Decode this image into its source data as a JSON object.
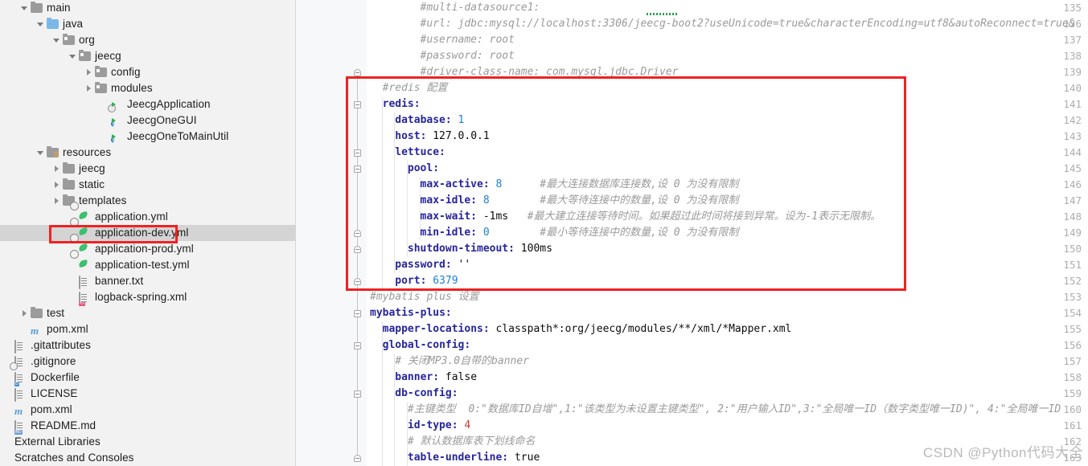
{
  "app": "IntelliJ IDEA project view with YAML editor",
  "sidebar": {
    "name": "project-tree",
    "items": [
      {
        "label": "main",
        "indent": 1,
        "arrow": "down",
        "icon": "folder-icon",
        "selected": false
      },
      {
        "label": "java",
        "indent": 2,
        "arrow": "down",
        "icon": "folder-source-icon",
        "selected": false
      },
      {
        "label": "org",
        "indent": 3,
        "arrow": "down",
        "icon": "folder-package-icon",
        "selected": false
      },
      {
        "label": "jeecg",
        "indent": 4,
        "arrow": "down",
        "icon": "folder-package-icon",
        "selected": false
      },
      {
        "label": "config",
        "indent": 5,
        "arrow": "right",
        "icon": "folder-package-icon",
        "selected": false
      },
      {
        "label": "modules",
        "indent": 5,
        "arrow": "right",
        "icon": "folder-package-icon",
        "selected": false
      },
      {
        "label": "JeecgApplication",
        "indent": 6,
        "arrow": "none",
        "icon": "java-class-run-icon",
        "selected": false
      },
      {
        "label": "JeecgOneGUI",
        "indent": 6,
        "arrow": "none",
        "icon": "java-class-icon",
        "selected": false
      },
      {
        "label": "JeecgOneToMainUtil",
        "indent": 6,
        "arrow": "none",
        "icon": "java-class-icon",
        "selected": false
      },
      {
        "label": "resources",
        "indent": 2,
        "arrow": "down",
        "icon": "folder-resources-icon",
        "selected": false
      },
      {
        "label": "jeecg",
        "indent": 3,
        "arrow": "right",
        "icon": "folder-icon",
        "selected": false
      },
      {
        "label": "static",
        "indent": 3,
        "arrow": "right",
        "icon": "folder-icon",
        "selected": false
      },
      {
        "label": "templates",
        "indent": 3,
        "arrow": "right",
        "icon": "folder-icon",
        "selected": false
      },
      {
        "label": "application.yml",
        "indent": 4,
        "arrow": "none",
        "icon": "yml-file-icon",
        "selected": false
      },
      {
        "label": "application-dev.yml",
        "indent": 4,
        "arrow": "none",
        "icon": "yml-file-icon",
        "selected": true
      },
      {
        "label": "application-prod.yml",
        "indent": 4,
        "arrow": "none",
        "icon": "yml-file-icon",
        "selected": false
      },
      {
        "label": "application-test.yml",
        "indent": 4,
        "arrow": "none",
        "icon": "yml-file-icon",
        "selected": false
      },
      {
        "label": "banner.txt",
        "indent": 4,
        "arrow": "none",
        "icon": "text-file-icon",
        "selected": false
      },
      {
        "label": "logback-spring.xml",
        "indent": 4,
        "arrow": "none",
        "icon": "xml-file-icon",
        "selected": false
      },
      {
        "label": "test",
        "indent": 1,
        "arrow": "right",
        "icon": "folder-icon",
        "selected": false
      },
      {
        "label": "pom.xml",
        "indent": 1,
        "arrow": "none",
        "icon": "maven-icon",
        "selected": false
      },
      {
        "label": ".gitattributes",
        "indent": 0,
        "arrow": "none",
        "icon": "text-file-icon",
        "selected": false
      },
      {
        "label": ".gitignore",
        "indent": 0,
        "arrow": "none",
        "icon": "gitignore-icon",
        "selected": false
      },
      {
        "label": "Dockerfile",
        "indent": 0,
        "arrow": "none",
        "icon": "docker-file-icon",
        "selected": false
      },
      {
        "label": "LICENSE",
        "indent": 0,
        "arrow": "none",
        "icon": "text-file-icon",
        "selected": false
      },
      {
        "label": "pom.xml",
        "indent": 0,
        "arrow": "none",
        "icon": "maven-icon",
        "selected": false
      },
      {
        "label": "README.md",
        "indent": 0,
        "arrow": "none",
        "icon": "markdown-file-icon",
        "selected": false
      },
      {
        "label": "External Libraries",
        "indent": 0,
        "arrow": "none",
        "icon": "none",
        "selected": false
      },
      {
        "label": "Scratches and Consoles",
        "indent": 0,
        "arrow": "none",
        "icon": "none",
        "selected": false
      }
    ]
  },
  "editor": {
    "name": "yaml-editor",
    "first_line_number": 135,
    "lines": [
      {
        "n": 135,
        "text": "#multi-datasource1:"
      },
      {
        "n": 136,
        "text": "#url: jdbc:mysql://localhost:3306/jeecg-boot2?useUnicode=true&characterEncoding=utf8&autoReconnect=true&"
      },
      {
        "n": 137,
        "text": "#username: root"
      },
      {
        "n": 138,
        "text": "#password: root"
      },
      {
        "n": 139,
        "text": "#driver-class-name: com.mysql.jdbc.Driver"
      },
      {
        "n": 140,
        "text": "#redis 配置"
      },
      {
        "n": 141,
        "text": "redis:"
      },
      {
        "n": 142,
        "text": "database: 1"
      },
      {
        "n": 143,
        "text": "host: 127.0.0.1"
      },
      {
        "n": 144,
        "text": "lettuce:"
      },
      {
        "n": 145,
        "text": "pool:"
      },
      {
        "n": 146,
        "text": "max-active: 8      #最大连接数据库连接数,设 0 为没有限制"
      },
      {
        "n": 147,
        "text": "max-idle: 8        #最大等待连接中的数量,设 0 为没有限制"
      },
      {
        "n": 148,
        "text": "max-wait: -1ms   #最大建立连接等待时间。如果超过此时间将接到异常。设为-1表示无限制。"
      },
      {
        "n": 149,
        "text": "min-idle: 0        #最小等待连接中的数量,设 0 为没有限制"
      },
      {
        "n": 150,
        "text": "shutdown-timeout: 100ms"
      },
      {
        "n": 151,
        "text": "password: ''"
      },
      {
        "n": 152,
        "text": "port: 6379"
      },
      {
        "n": 153,
        "text": "#mybatis plus 设置"
      },
      {
        "n": 154,
        "text": "mybatis-plus:"
      },
      {
        "n": 155,
        "text": "mapper-locations: classpath*:org/jeecg/modules/**/xml/*Mapper.xml"
      },
      {
        "n": 156,
        "text": "global-config:"
      },
      {
        "n": 157,
        "text": "# 关闭MP3.0自带的banner"
      },
      {
        "n": 158,
        "text": "banner: false"
      },
      {
        "n": 159,
        "text": "db-config:"
      },
      {
        "n": 160,
        "text": "#主键类型  0:\"数据库ID自增\",1:\"该类型为未设置主键类型\", 2:\"用户输入ID\",3:\"全局唯一ID（数字类型唯一ID)\", 4:\"全局唯一ID"
      },
      {
        "n": 161,
        "text": "id-type: 4"
      },
      {
        "n": 162,
        "text": "# 默认数据库表下划线命名"
      },
      {
        "n": 163,
        "text": "table-underline: true"
      }
    ],
    "values": {
      "database": "1",
      "host": "127.0.0.1",
      "max_active": "8",
      "max_idle": "8",
      "max_wait": "-1ms",
      "min_idle": "0",
      "shutdown_timeout": "100ms",
      "password": "''",
      "port": "6379",
      "banner": "false",
      "id_type": "4",
      "table_underline": "true"
    }
  },
  "annotations": {
    "highlight_color": "#ee2222",
    "boxes": [
      {
        "name": "redis-config-highlight",
        "label": "redis configuration block lines 140-152"
      },
      {
        "name": "selected-file-highlight",
        "label": "application-dev.yml"
      }
    ]
  },
  "watermark": {
    "text": "CSDN @Python代码大全"
  }
}
